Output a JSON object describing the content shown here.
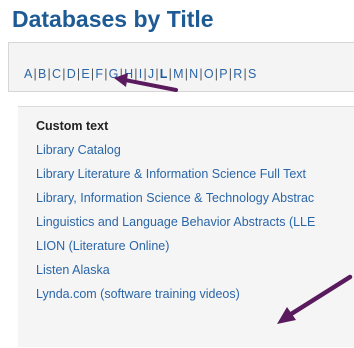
{
  "page": {
    "title": "Databases by Title"
  },
  "az_nav": {
    "letters": [
      "A",
      "B",
      "C",
      "D",
      "E",
      "F",
      "G",
      "H",
      "I",
      "J",
      "L",
      "M",
      "N",
      "O",
      "P",
      "R",
      "S"
    ],
    "active": "L"
  },
  "list": {
    "header": "Custom text",
    "items": [
      "Library Catalog",
      "Library Literature & Information Science Full Text",
      "Library, Information Science & Technology Abstrac",
      "Linguistics and Language Behavior Abstracts (LLE",
      "LION (Literature Online)",
      "Listen Alaska",
      "Lynda.com (software training videos)"
    ]
  },
  "colors": {
    "title": "#1e5b94",
    "link": "#2a66a8",
    "arrow": "#5a1a5e"
  },
  "icons": [
    "arrow-icon"
  ]
}
